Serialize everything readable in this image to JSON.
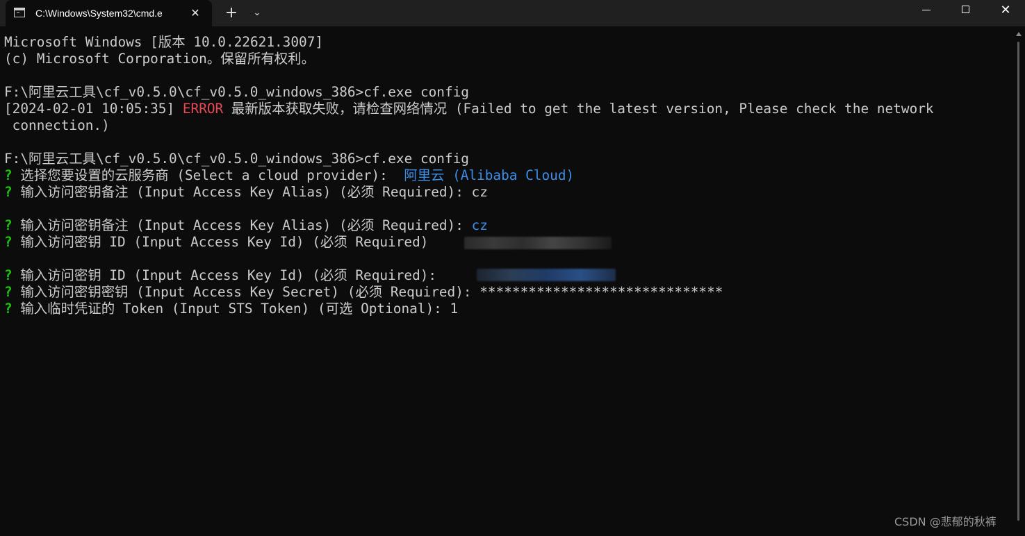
{
  "titlebar": {
    "tab_title": "C:\\Windows\\System32\\cmd.e",
    "tab_close": "✕",
    "new_tab": "+",
    "dropdown": "⌄",
    "close": "✕"
  },
  "terminal": {
    "banner_line1": "Microsoft Windows [版本 10.0.22621.3007]",
    "banner_line2": "(c) Microsoft Corporation。保留所有权利。",
    "prompt1": "F:\\阿里云工具\\cf_v0.5.0\\cf_v0.5.0_windows_386>cf.exe config",
    "error_timestamp": "[2024-02-01 10:05:35] ",
    "error_tag": "ERROR",
    "error_message": " 最新版本获取失败，请检查网络情况 (Failed to get the latest version, Please check the network",
    "error_message_cont": " connection.)",
    "prompt2": "F:\\阿里云工具\\cf_v0.5.0\\cf_v0.5.0_windows_386>cf.exe config",
    "q_mark": "?",
    "q1_label": " 选择您要设置的云服务商 (Select a cloud provider):  ",
    "q1_value": "阿里云 (Alibaba Cloud)",
    "q2_label": " 输入访问密钥备注 (Input Access Key Alias) (必须 Required): cz",
    "q3_label": " 输入访问密钥备注 (Input Access Key Alias) (必须 Required): ",
    "q3_value": "cz",
    "q4_label": " 输入访问密钥 ID (Input Access Key Id) (必须 Required)",
    "q5_label": " 输入访问密钥 ID (Input Access Key Id) (必须 Required): ",
    "q6_label": " 输入访问密钥密钥 (Input Access Key Secret) (必须 Required): ******************************",
    "q7_label": " 输入临时凭证的 Token (Input STS Token) (可选 Optional): 1"
  },
  "watermark": "CSDN @悲郁的秋裤",
  "colors": {
    "background": "#0c0c0c",
    "text": "#cccccc",
    "prompt_mark": "#16c60c",
    "error": "#e74856",
    "selected": "#3b8eea"
  }
}
